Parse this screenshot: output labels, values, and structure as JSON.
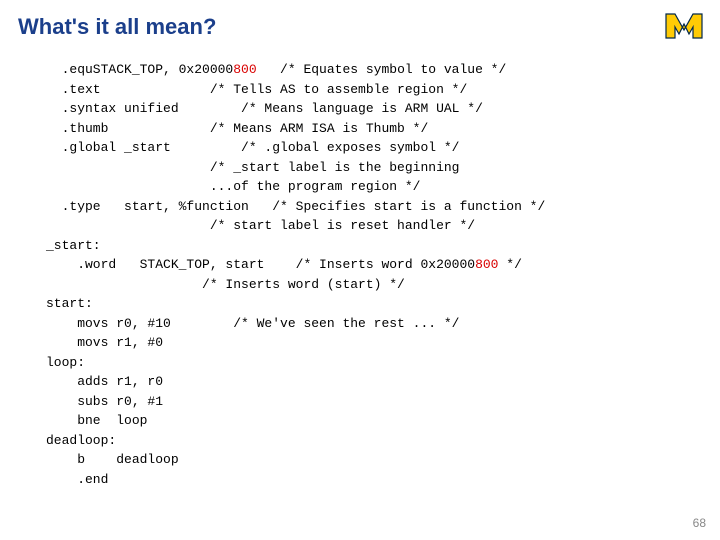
{
  "title": "What's it all mean?",
  "page_number": "68",
  "logo_fill": "#ffcb05",
  "logo_stroke": "#00274c",
  "code": {
    "l1a": "  .equSTACK_TOP, 0x20000",
    "l1b": "800",
    "l1c": "   /* Equates symbol to value */",
    "l2": "  .text              /* Tells AS to assemble region */",
    "l3": "  .syntax unified        /* Means language is ARM UAL */",
    "l4": "  .thumb             /* Means ARM ISA is Thumb */",
    "l5": "  .global _start         /* .global exposes symbol */",
    "l6": "                     /* _start label is the beginning",
    "l7": "                     ...of the program region */",
    "l8": "  .type   start, %function   /* Specifies start is a function */",
    "l9": "                     /* start label is reset handler */",
    "l10": "_start:",
    "l11a": "    .word   STACK_TOP, start    /* Inserts word 0x20000",
    "l11b": "800",
    "l11c": " */",
    "l12": "                    /* Inserts word (start) */",
    "l13": "start:",
    "l14": "    movs r0, #10        /* We've seen the rest ... */",
    "l15": "    movs r1, #0",
    "l16": "loop:",
    "l17": "    adds r1, r0",
    "l18": "    subs r0, #1",
    "l19": "    bne  loop",
    "l20": "deadloop:",
    "l21": "    b    deadloop",
    "l22": "    .end"
  }
}
